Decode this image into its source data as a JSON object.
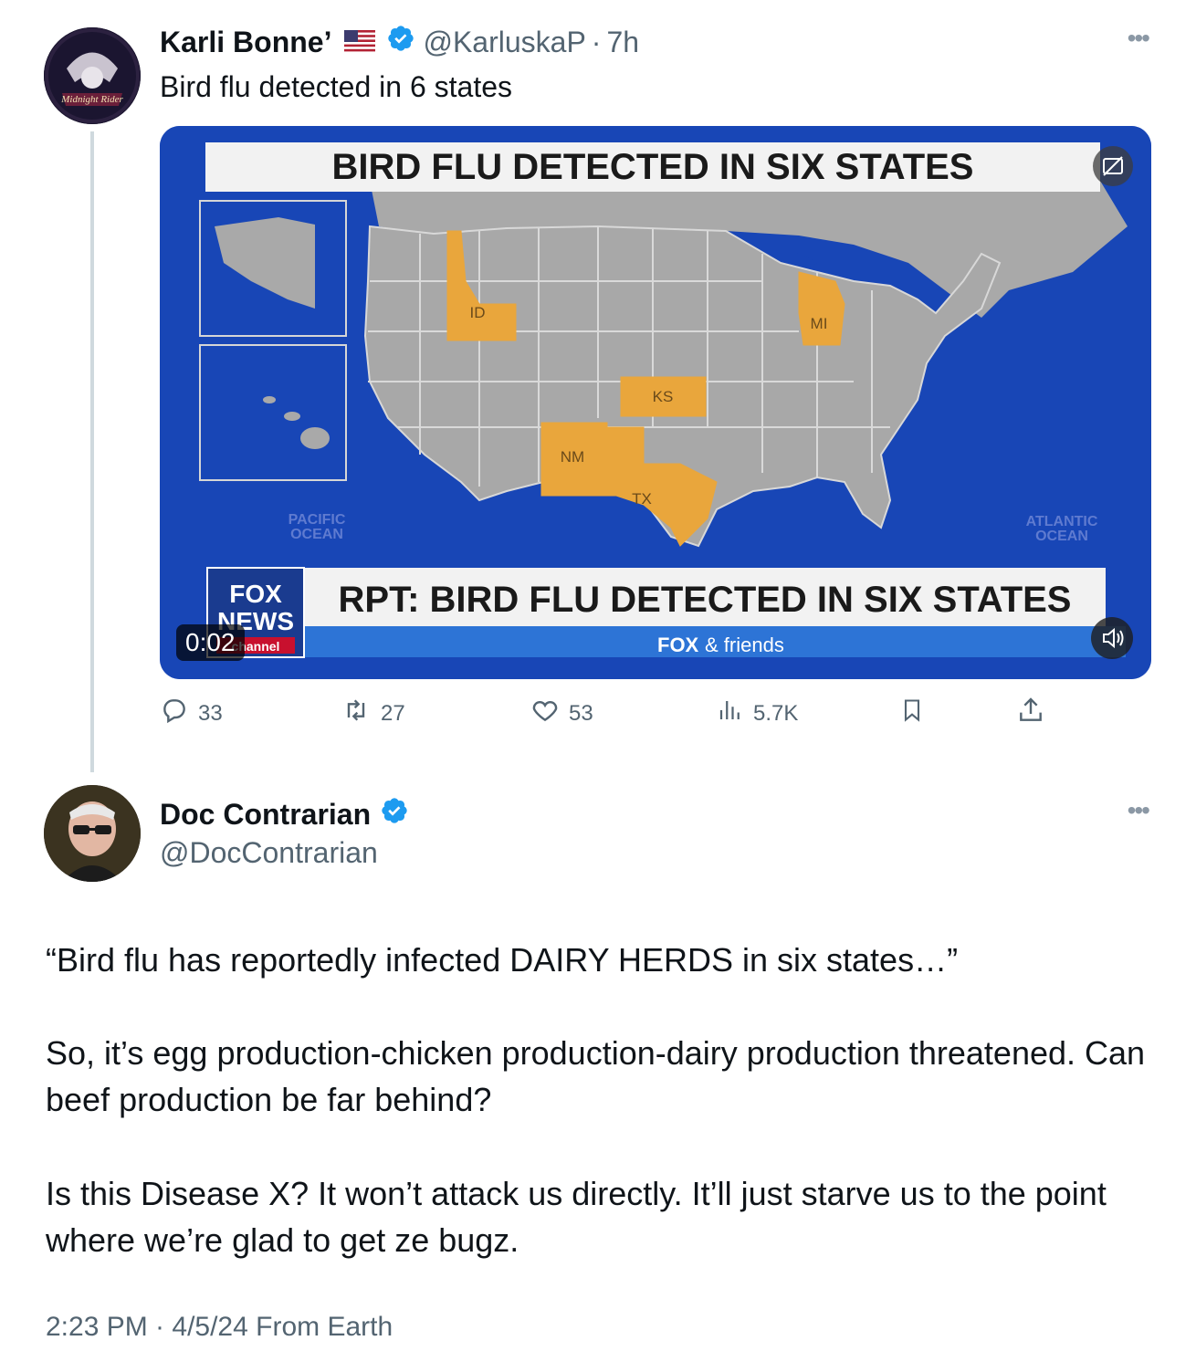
{
  "tweet1": {
    "author_name": "Karli Bonne’",
    "flag": "us-flag-icon",
    "handle": "@KarluskaP",
    "separator": "·",
    "time": "7h",
    "text": "Bird flu detected in 6 states",
    "video": {
      "headline_top": "BIRD FLU DETECTED IN SIX STATES",
      "headline_bottom": "RPT: BIRD FLU DETECTED IN SIX STATES",
      "network_logo_line1": "FOX",
      "network_logo_line2": "NEWS",
      "network_logo_line3": "channel",
      "show_name_part1": "FOX",
      "show_name_part2": "& friends",
      "ocean_left": "PACIFIC",
      "ocean_left2": "OCEAN",
      "ocean_right": "ATLANTIC",
      "ocean_right2": "OCEAN",
      "state_labels": [
        "ID",
        "KS",
        "NM",
        "TX",
        "MI"
      ],
      "elapsed": "0:02"
    },
    "stats": {
      "replies": "33",
      "reposts": "27",
      "likes": "53",
      "views": "5.7K"
    }
  },
  "tweet2": {
    "author_name": "Doc Contrarian",
    "handle": "@DocContrarian",
    "paragraph1": "“Bird flu has reportedly infected DAIRY HERDS in six states…”",
    "paragraph2": "So, it’s egg production-chicken production-dairy production threatened. Can beef production be far behind?",
    "paragraph3": "Is this Disease X? It won’t attack us directly. It’ll just starve us to the point where we’re glad to get ze bugz.",
    "footer": "2:23 PM · 4/5/24 From Earth"
  },
  "colors": {
    "accent": "#1d9bf0",
    "muted": "#536471",
    "highlight_state": "#e9a63c",
    "ocean": "#1846b6"
  }
}
